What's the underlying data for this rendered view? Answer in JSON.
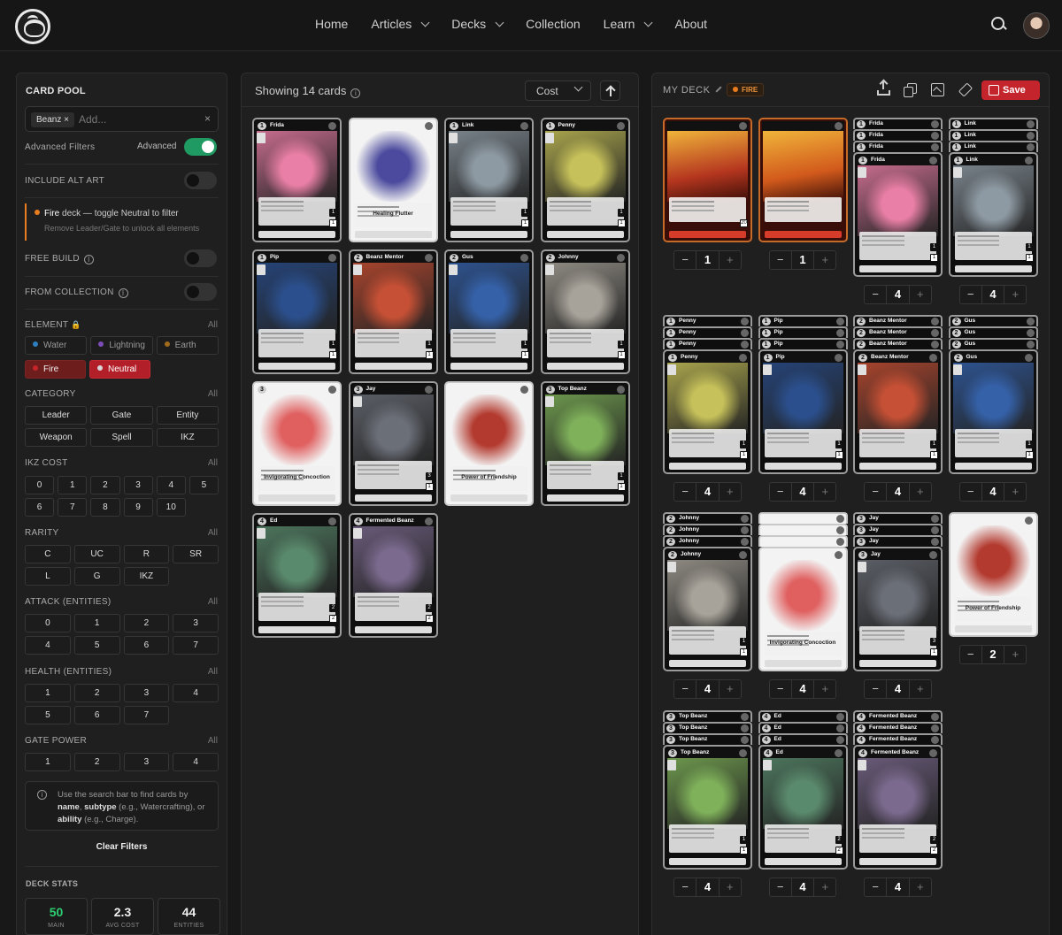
{
  "nav": {
    "items": [
      {
        "label": "Home",
        "dropdown": false
      },
      {
        "label": "Articles",
        "dropdown": true
      },
      {
        "label": "Decks",
        "dropdown": true
      },
      {
        "label": "Collection",
        "dropdown": false
      },
      {
        "label": "Learn",
        "dropdown": true
      },
      {
        "label": "About",
        "dropdown": false
      }
    ]
  },
  "card_pool": {
    "title": "CARD POOL",
    "search_chip": "Beanz ×",
    "search_placeholder": "Add...",
    "clear": "×",
    "advanced_filters": "Advanced Filters",
    "advanced_label": "Advanced",
    "include_alt_art": "INCLUDE ALT ART",
    "notice_element": "Fire",
    "notice_rest": " deck — toggle Neutral to filter",
    "notice_sub": "Remove Leader/Gate to unlock all elements",
    "free_build": "FREE BUILD",
    "from_collection": "FROM COLLECTION",
    "element_label": "ELEMENT",
    "all": "All",
    "elements": [
      {
        "label": "Water",
        "color": "#2e7fbf",
        "state": "off"
      },
      {
        "label": "Lightning",
        "color": "#7b4bb8",
        "state": "off"
      },
      {
        "label": "Earth",
        "color": "#a06a1c",
        "state": "off"
      },
      {
        "label": "Fire",
        "color": "#c4242c",
        "state": "fire"
      },
      {
        "label": "Neutral",
        "color": "#d8d8d8",
        "state": "neutral"
      }
    ],
    "category_label": "CATEGORY",
    "categories": [
      "Leader",
      "Gate",
      "Entity",
      "Weapon",
      "Spell",
      "IKZ"
    ],
    "ikz_cost_label": "IKZ COST",
    "ikz_costs": [
      "0",
      "1",
      "2",
      "3",
      "4",
      "5",
      "6",
      "7",
      "8",
      "9",
      "10"
    ],
    "rarity_label": "RARITY",
    "rarities": [
      "C",
      "UC",
      "R",
      "SR",
      "L",
      "G",
      "IKZ"
    ],
    "attack_label": "ATTACK (ENTITIES)",
    "attacks": [
      "0",
      "1",
      "2",
      "3",
      "4",
      "5",
      "6",
      "7"
    ],
    "health_label": "HEALTH (ENTITIES)",
    "healths": [
      "1",
      "2",
      "3",
      "4",
      "5",
      "6",
      "7"
    ],
    "gate_power_label": "GATE POWER",
    "gate_powers": [
      "1",
      "2",
      "3",
      "4"
    ],
    "tip_1": "Use the search bar to find cards by ",
    "tip_b1": "name",
    "tip_2": ", ",
    "tip_b2": "subtype",
    "tip_3": " (e.g., Watercrafting), or ",
    "tip_b3": "ability",
    "tip_4": " (e.g., Charge).",
    "clear_filters": "Clear Filters",
    "deck_stats_title": "DECK STATS",
    "stats": [
      {
        "value": "50",
        "label": "MAIN",
        "color": "#2ecc71"
      },
      {
        "value": "2.3",
        "label": "AVG COST",
        "color": "#eeeeee"
      },
      {
        "value": "44",
        "label": "ENTITIES",
        "color": "#eeeeee"
      }
    ]
  },
  "results": {
    "showing": "Showing 14 cards",
    "sort": "Cost",
    "cards": [
      {
        "cost": "1",
        "name": "Frida",
        "kind": "entity",
        "art": "#e97fa6",
        "atk": "1",
        "hp": "1"
      },
      {
        "cost": "",
        "name": "",
        "kind": "spell",
        "title": "Healing Flutter",
        "art": "#4b4a9e"
      },
      {
        "cost": "1",
        "name": "Link",
        "kind": "entity",
        "art": "#8e9aa3",
        "atk": "1",
        "hp": "1"
      },
      {
        "cost": "1",
        "name": "Penny",
        "kind": "entity",
        "art": "#c6c15a",
        "atk": "1",
        "hp": "1"
      },
      {
        "cost": "1",
        "name": "Pip",
        "kind": "entity",
        "art": "#2b4f8c",
        "atk": "1",
        "hp": "1"
      },
      {
        "cost": "2",
        "name": "Beanz Mentor",
        "kind": "entity",
        "art": "#c55035",
        "atk": "1",
        "hp": "1"
      },
      {
        "cost": "2",
        "name": "Gus",
        "kind": "entity",
        "art": "#3561a8",
        "atk": "1",
        "hp": "1"
      },
      {
        "cost": "2",
        "name": "Johnny",
        "kind": "entity",
        "art": "#a8a39a",
        "atk": "1",
        "hp": "1"
      },
      {
        "cost": "3",
        "name": "",
        "kind": "spell",
        "title": "Invigorating Concoction",
        "art": "#e06060"
      },
      {
        "cost": "3",
        "name": "Jay",
        "kind": "entity",
        "art": "#6b6f78",
        "atk": "3",
        "hp": "1"
      },
      {
        "cost": "",
        "name": "",
        "kind": "spell",
        "title": "Power of Friendship",
        "art": "#b33a2f"
      },
      {
        "cost": "3",
        "name": "Top Beanz",
        "kind": "entity",
        "art": "#7fb15a",
        "atk": "1",
        "hp": "1"
      },
      {
        "cost": "4",
        "name": "Ed",
        "kind": "entity",
        "art": "#5a8a6d",
        "atk": "2",
        "hp": "2"
      },
      {
        "cost": "4",
        "name": "Fermented Beanz",
        "kind": "entity",
        "art": "#7b6a8e",
        "atk": "2",
        "hp": "2"
      }
    ]
  },
  "deck": {
    "title": "MY DECK",
    "element": "FIRE",
    "save": "Save",
    "entries": [
      {
        "cost": "",
        "name": "",
        "kind": "leader",
        "art": "#b5361f",
        "qty": "1",
        "stack": 1,
        "atk": "",
        "hp": "20"
      },
      {
        "cost": "",
        "name": "",
        "kind": "leader",
        "art": "#d25a1c",
        "qty": "1",
        "stack": 1,
        "atk": "",
        "hp": ""
      },
      {
        "cost": "1",
        "name": "Frida",
        "kind": "entity",
        "art": "#e97fa6",
        "qty": "4",
        "stack": 4,
        "atk": "1",
        "hp": "1"
      },
      {
        "cost": "1",
        "name": "Link",
        "kind": "entity",
        "art": "#8e9aa3",
        "qty": "4",
        "stack": 4,
        "atk": "1",
        "hp": "1"
      },
      {
        "cost": "1",
        "name": "Penny",
        "kind": "entity",
        "art": "#c6c15a",
        "qty": "4",
        "stack": 4,
        "atk": "1",
        "hp": "1"
      },
      {
        "cost": "1",
        "name": "Pip",
        "kind": "entity",
        "art": "#2b4f8c",
        "qty": "4",
        "stack": 4,
        "atk": "1",
        "hp": "1"
      },
      {
        "cost": "2",
        "name": "Beanz Mentor",
        "kind": "entity",
        "art": "#c55035",
        "qty": "4",
        "stack": 4,
        "atk": "1",
        "hp": "1"
      },
      {
        "cost": "2",
        "name": "Gus",
        "kind": "entity",
        "art": "#3561a8",
        "qty": "4",
        "stack": 4,
        "atk": "1",
        "hp": "1"
      },
      {
        "cost": "2",
        "name": "Johnny",
        "kind": "entity",
        "art": "#a8a39a",
        "qty": "4",
        "stack": 4,
        "atk": "1",
        "hp": "1"
      },
      {
        "cost": "",
        "name": "",
        "kind": "spell",
        "title": "Invigorating Concoction",
        "art": "#e06060",
        "qty": "4",
        "stack": 4
      },
      {
        "cost": "3",
        "name": "Jay",
        "kind": "entity",
        "art": "#6b6f78",
        "qty": "4",
        "stack": 4,
        "atk": "3",
        "hp": "1"
      },
      {
        "cost": "",
        "name": "",
        "kind": "spell",
        "title": "Power of Friendship",
        "art": "#b33a2f",
        "qty": "2",
        "stack": 1
      },
      {
        "cost": "3",
        "name": "Top Beanz",
        "kind": "entity",
        "art": "#7fb15a",
        "qty": "4",
        "stack": 4,
        "atk": "1",
        "hp": "1"
      },
      {
        "cost": "4",
        "name": "Ed",
        "kind": "entity",
        "art": "#5a8a6d",
        "qty": "4",
        "stack": 4,
        "atk": "2",
        "hp": "2"
      },
      {
        "cost": "4",
        "name": "Fermented Beanz",
        "kind": "entity",
        "art": "#7b6a8e",
        "qty": "4",
        "stack": 4,
        "atk": "2",
        "hp": "2"
      }
    ]
  }
}
